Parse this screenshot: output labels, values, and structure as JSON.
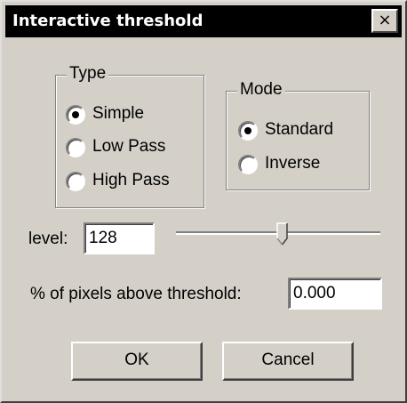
{
  "window": {
    "title": "Interactive threshold",
    "close_glyph": "×"
  },
  "type_group": {
    "label": "Type",
    "options": [
      {
        "label": "Simple",
        "selected": true
      },
      {
        "label": "Low Pass",
        "selected": false
      },
      {
        "label": "High Pass",
        "selected": false
      }
    ]
  },
  "mode_group": {
    "label": "Mode",
    "options": [
      {
        "label": "Standard",
        "selected": true
      },
      {
        "label": "Inverse",
        "selected": false
      }
    ]
  },
  "level": {
    "label": "level:",
    "value": "128"
  },
  "pixels_above": {
    "label": "% of pixels above threshold:",
    "value": "0.000"
  },
  "buttons": {
    "ok": "OK",
    "cancel": "Cancel"
  }
}
